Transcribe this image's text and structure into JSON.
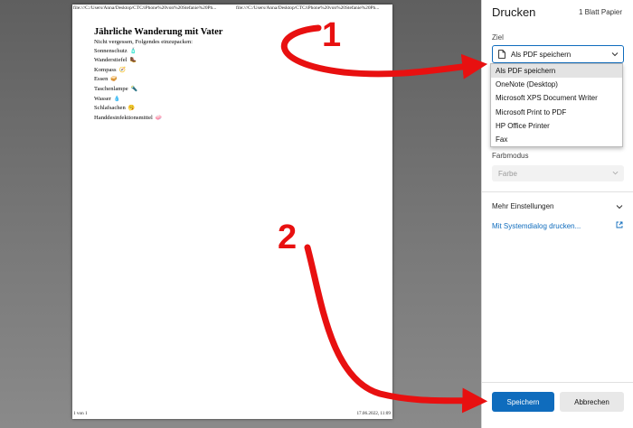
{
  "preview": {
    "header_left": "file:///C:/Users/Anna/Desktop/CTC/iPhone%20von%20Stefanie%20Ph...",
    "header_right": "file:///C:/Users/Anna/Desktop/CTC/iPhone%20von%20Stefanie%20Ph...",
    "title": "Jährliche Wanderung mit Vater",
    "lines": [
      {
        "text": "Nicht vergessen, Folgendes einzupacken:",
        "emoji": ""
      },
      {
        "text": "Sonnenschutz",
        "emoji": "🧴"
      },
      {
        "text": "Wanderstiefel",
        "emoji": "🥾"
      },
      {
        "text": "Kompass",
        "emoji": "🧭"
      },
      {
        "text": "Essen",
        "emoji": "🥪"
      },
      {
        "text": "Taschenlampe",
        "emoji": "🔦"
      },
      {
        "text": "Wasser",
        "emoji": "💧"
      },
      {
        "text": "Schlafsachen",
        "emoji": "🥱"
      },
      {
        "text": "Handdesinfektionsmittel",
        "emoji": "🧼"
      }
    ],
    "footer_left": "1 von 1",
    "footer_right": "17.06.2022, 11:09"
  },
  "panel": {
    "title": "Drucken",
    "sheets": "1 Blatt Papier",
    "ziel_label": "Ziel",
    "ziel_value": "Als PDF speichern",
    "options": [
      "Als PDF speichern",
      "OneNote (Desktop)",
      "Microsoft XPS Document Writer",
      "Microsoft Print to PDF",
      "HP Office Printer",
      "Fax"
    ],
    "farbmodus_label": "Farbmodus",
    "farbe_value": "Farbe",
    "more_settings": "Mehr Einstellungen",
    "system_dialog": "Mit Systemdialog drucken...",
    "save_button": "Speichern",
    "cancel_button": "Abbrechen"
  },
  "annotations": {
    "step1": "1",
    "step2": "2",
    "color": "#e81010"
  },
  "colors": {
    "accent": "#0f6cbd",
    "arrow": "#e81010"
  }
}
